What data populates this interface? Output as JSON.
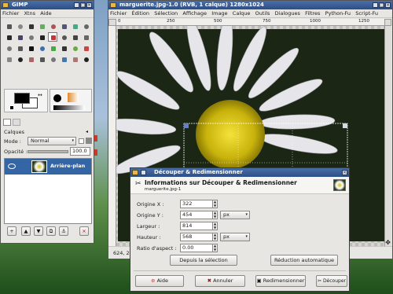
{
  "toolbox": {
    "title": "GIMP",
    "menu": [
      "Fichier",
      "Xtns",
      "Aide"
    ],
    "tool_icons": [
      "rect-select-icon",
      "ellipse-select-icon",
      "lasso-icon",
      "fuzzy-select-icon",
      "color-select-icon",
      "scissors-icon",
      "foreground-select-icon",
      "paths-icon",
      "color-picker-icon",
      "zoom-icon",
      "measure-icon",
      "move-icon",
      "crop-icon",
      "rotate-icon",
      "scale-icon",
      "shear-icon",
      "perspective-icon",
      "flip-icon",
      "text-icon",
      "bucket-fill-icon",
      "blend-icon",
      "pencil-icon",
      "paintbrush-icon",
      "eraser-icon",
      "airbrush-icon",
      "ink-icon",
      "clone-icon",
      "heal-icon",
      "perspective-clone-icon",
      "blur-icon",
      "smudge-icon",
      "dodge-burn-icon"
    ],
    "selected_tool_index": 12
  },
  "layers": {
    "title": "Calques",
    "mode_label": "Mode :",
    "mode_value": "Normal",
    "opacity_label": "Opacité :",
    "opacity_value": "100.0",
    "layer_name": "Arrière-plan"
  },
  "image_window": {
    "title": "marguerite.jpg-1.0 (RVB, 1 calque) 1280x1024",
    "menu": [
      "Fichier",
      "Édition",
      "Sélection",
      "Affichage",
      "Image",
      "Calque",
      "Outils",
      "Dialogues",
      "Filtres",
      "Python-Fu",
      "Script-Fu"
    ],
    "ruler_marks": [
      "0",
      "250",
      "500",
      "750",
      "1000",
      "1250"
    ],
    "status_coords": "624, 2"
  },
  "dialog": {
    "title": "Découper & Redimensionner",
    "header": "Informations sur Découper & Redimensionner",
    "subheader": "marguerite.jpg-1",
    "fields": {
      "origin_x_label": "Origine X :",
      "origin_x_value": "322",
      "origin_y_label": "Origine Y :",
      "origin_y_value": "454",
      "width_label": "Largeur :",
      "width_value": "814",
      "height_label": "Hauteur :",
      "height_value": "568",
      "aspect_label": "Ratio d'aspect :",
      "aspect_value": "0.00",
      "unit": "px"
    },
    "from_selection": "Depuis la sélection",
    "auto_shrink": "Réduction automatique",
    "buttons": {
      "help": "Aide",
      "cancel": "Annuler",
      "resize": "Redimensionner",
      "crop": "Découper"
    }
  },
  "colors": {
    "titlebar": "#2c4f86",
    "layer_selected": "#3465a4"
  }
}
